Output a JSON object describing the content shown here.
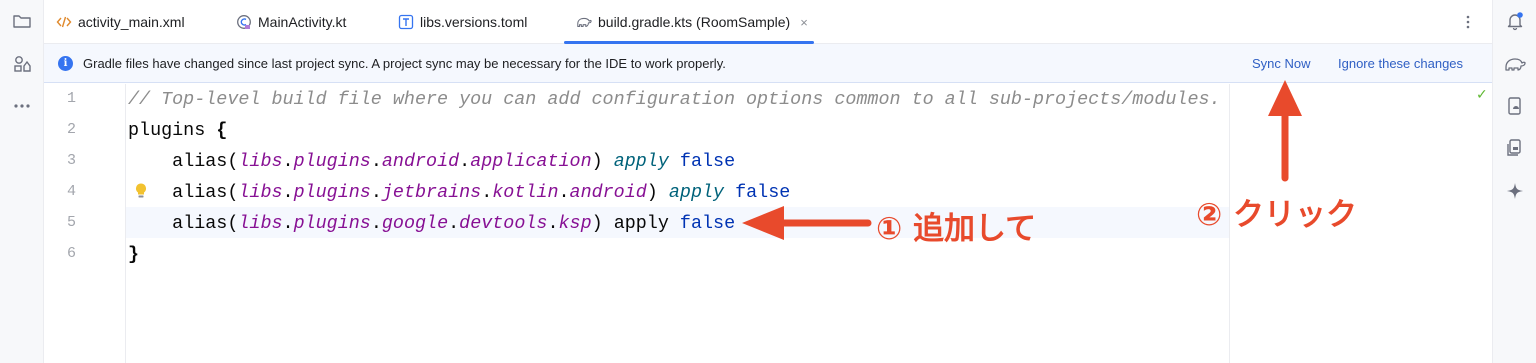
{
  "left_strip": {
    "icons": [
      "folder-icon",
      "shapes-icon",
      "more-icon"
    ]
  },
  "tabs": [
    {
      "label": "activity_main.xml",
      "icon": "xml-icon"
    },
    {
      "label": "MainActivity.kt",
      "icon": "kotlin-class-icon"
    },
    {
      "label": "libs.versions.toml",
      "icon": "toml-icon"
    },
    {
      "label": "build.gradle.kts (RoomSample)",
      "icon": "gradle-icon",
      "active": true,
      "close": "×"
    }
  ],
  "banner": {
    "info_glyph": "i",
    "message": "Gradle files have changed since last project sync. A project sync may be necessary for the IDE to work properly.",
    "sync_now": "Sync Now",
    "ignore": "Ignore these changes"
  },
  "editor": {
    "line_numbers": [
      "1",
      "2",
      "3",
      "4",
      "5",
      "6"
    ],
    "lines": {
      "l1": "// Top-level build file where you can add configuration options common to all sub-projects/modules.",
      "l2a": "plugins ",
      "l2b": "{",
      "alias": "alias(",
      "libs": "libs",
      "plugins": "plugins",
      "dot": ".",
      "android": "android",
      "application": "application",
      "jetbrains": "jetbrains",
      "kotlin": "kotlin",
      "google": "google",
      "devtools": "devtools",
      "ksp": "ksp",
      "close_paren": ") ",
      "apply": "apply",
      "space": " ",
      "false": "false",
      "l6": "}"
    },
    "caret_line": 5,
    "inspection_status": "✓"
  },
  "annotations": {
    "step1": "① 追加して",
    "step2": "② クリック",
    "color": "#e84a2c"
  },
  "right_strip": {
    "icons": [
      "notifications-icon",
      "gradle-elephant-icon",
      "device-manager-icon",
      "running-devices-icon",
      "gemini-icon"
    ]
  },
  "colors": {
    "accent": "#3574f0",
    "link": "#2f5fc4",
    "comment": "#8c8c8c",
    "keyword": "#0033b3",
    "property": "#871094",
    "call": "#00627a"
  }
}
